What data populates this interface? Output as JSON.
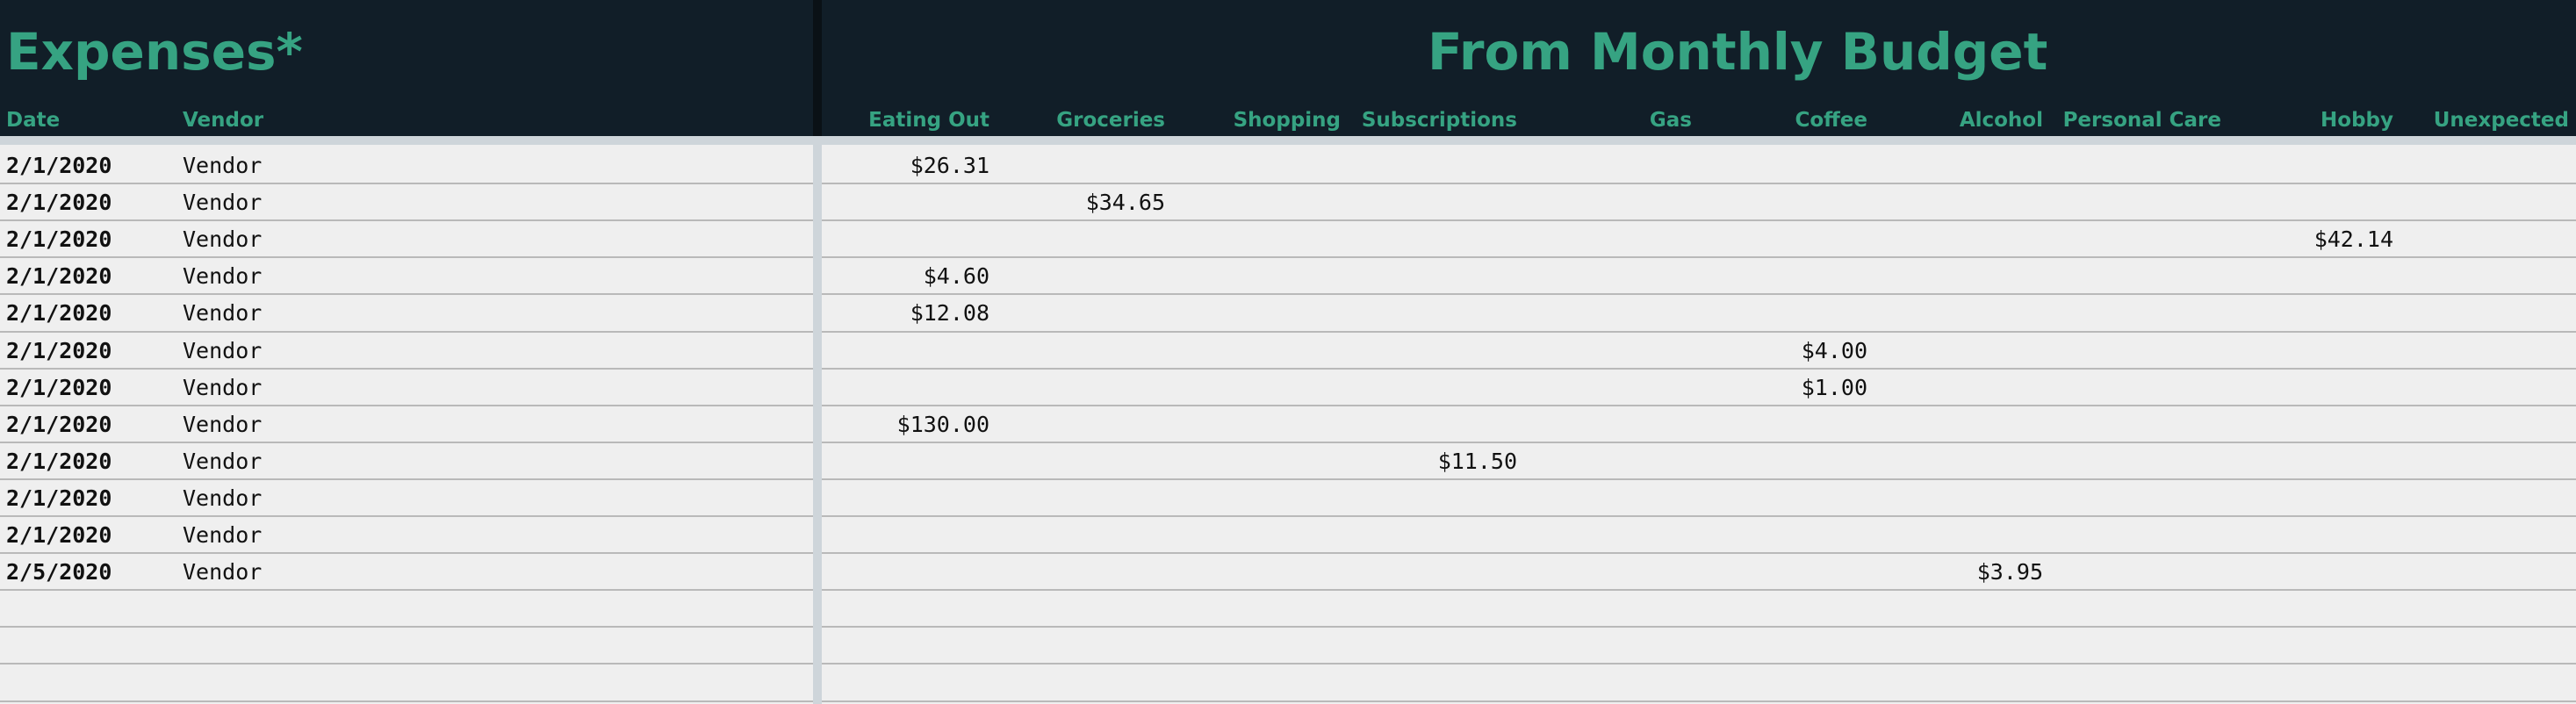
{
  "header": {
    "left_title": "Expenses*",
    "right_title": "From Monthly Budget"
  },
  "columns": {
    "date": "Date",
    "vendor": "Vendor",
    "categories": [
      "Eating Out",
      "Groceries",
      "Shopping",
      "Subscriptions",
      "Gas",
      "Coffee",
      "Alcohol",
      "Personal Care",
      "Hobby",
      "Unexpected"
    ]
  },
  "rows": [
    {
      "date": "2/1/2020",
      "vendor": "Vendor",
      "amounts": [
        "$26.31",
        "",
        "",
        "",
        "",
        "",
        "",
        "",
        "",
        ""
      ]
    },
    {
      "date": "2/1/2020",
      "vendor": "Vendor",
      "amounts": [
        "",
        "$34.65",
        "",
        "",
        "",
        "",
        "",
        "",
        "",
        ""
      ]
    },
    {
      "date": "2/1/2020",
      "vendor": "Vendor",
      "amounts": [
        "",
        "",
        "",
        "",
        "",
        "",
        "",
        "",
        "$42.14",
        ""
      ]
    },
    {
      "date": "2/1/2020",
      "vendor": "Vendor",
      "amounts": [
        "$4.60",
        "",
        "",
        "",
        "",
        "",
        "",
        "",
        "",
        ""
      ]
    },
    {
      "date": "2/1/2020",
      "vendor": "Vendor",
      "amounts": [
        "$12.08",
        "",
        "",
        "",
        "",
        "",
        "",
        "",
        "",
        ""
      ]
    },
    {
      "date": "2/1/2020",
      "vendor": "Vendor",
      "amounts": [
        "",
        "",
        "",
        "",
        "",
        "$4.00",
        "",
        "",
        "",
        ""
      ]
    },
    {
      "date": "2/1/2020",
      "vendor": "Vendor",
      "amounts": [
        "",
        "",
        "",
        "",
        "",
        "$1.00",
        "",
        "",
        "",
        ""
      ]
    },
    {
      "date": "2/1/2020",
      "vendor": "Vendor",
      "amounts": [
        "$130.00",
        "",
        "",
        "",
        "",
        "",
        "",
        "",
        "",
        ""
      ]
    },
    {
      "date": "2/1/2020",
      "vendor": "Vendor",
      "amounts": [
        "",
        "",
        "",
        "$11.50",
        "",
        "",
        "",
        "",
        "",
        ""
      ]
    },
    {
      "date": "2/1/2020",
      "vendor": "Vendor",
      "amounts": [
        "",
        "",
        "",
        "",
        "",
        "",
        "",
        "",
        "",
        ""
      ]
    },
    {
      "date": "2/1/2020",
      "vendor": "Vendor",
      "amounts": [
        "",
        "",
        "",
        "",
        "",
        "",
        "",
        "",
        "",
        ""
      ]
    },
    {
      "date": "2/5/2020",
      "vendor": "Vendor",
      "amounts": [
        "",
        "",
        "",
        "",
        "",
        "",
        "$3.95",
        "",
        "",
        ""
      ]
    },
    {
      "date": "",
      "vendor": "",
      "amounts": [
        "",
        "",
        "",
        "",
        "",
        "",
        "",
        "",
        "",
        ""
      ]
    },
    {
      "date": "",
      "vendor": "",
      "amounts": [
        "",
        "",
        "",
        "",
        "",
        "",
        "",
        "",
        "",
        ""
      ]
    },
    {
      "date": "",
      "vendor": "",
      "amounts": [
        "",
        "",
        "",
        "",
        "",
        "",
        "",
        "",
        "",
        ""
      ]
    }
  ],
  "colors": {
    "header_bg": "#111e28",
    "accent": "#36a382",
    "sheet_bg": "#efefef",
    "grid_line": "#b9b9b9"
  }
}
